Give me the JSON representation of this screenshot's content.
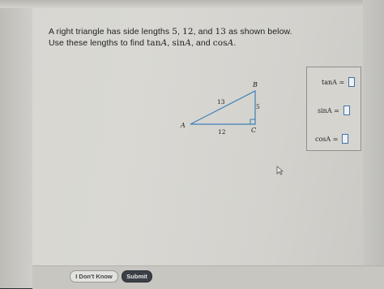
{
  "question": {
    "line1": {
      "prefix": "A right triangle has side lengths ",
      "a": "5",
      "sep1": ", ",
      "b": "12",
      "sep2": ", and ",
      "c": "13",
      "suffix": " as shown below."
    },
    "line2": {
      "prefix": "Use these lengths to find ",
      "tan": "tan",
      "tanA": "A",
      "sep1": ", ",
      "sin": "sin",
      "sinA": "A",
      "sep2": ", and ",
      "cos": "cos",
      "cosA": "A",
      "suffix": "."
    }
  },
  "triangle": {
    "vertex_a": "A",
    "vertex_b": "B",
    "vertex_c": "C",
    "side_hyp": "13",
    "side_vert": "5",
    "side_base": "12"
  },
  "answers": [
    {
      "label": "tanA =",
      "value": ""
    },
    {
      "label": "sinA =",
      "value": ""
    },
    {
      "label": "cosA =",
      "value": ""
    }
  ],
  "footer": {
    "dont_know": "I Don't Know",
    "submit": "Submit"
  },
  "colors": {
    "input_border": "#3d74b0",
    "triangle_stroke": "#3e7fb9",
    "submit_bg": "#3b4047"
  }
}
